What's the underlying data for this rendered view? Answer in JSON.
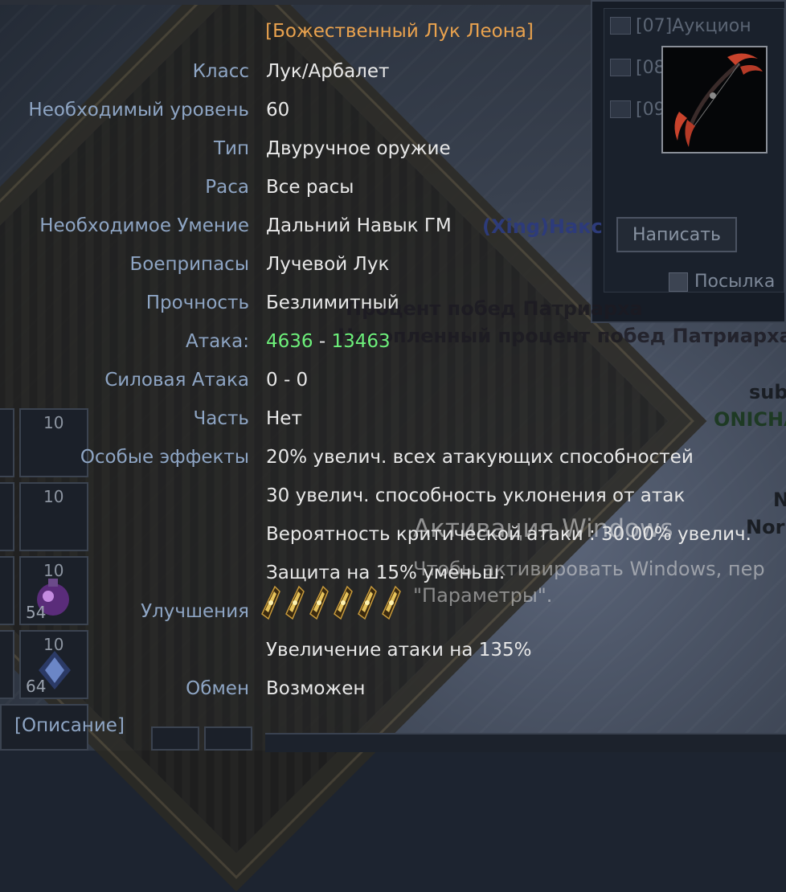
{
  "item": {
    "title": "[Божественный Лук Леона]",
    "properties": [
      {
        "label": "Класс",
        "value": "Лук/Арбалет"
      },
      {
        "label": "Необходимый уровень",
        "value": "60"
      },
      {
        "label": "Тип",
        "value": "Двуручное оружие"
      },
      {
        "label": "Раса",
        "value": "Все расы"
      },
      {
        "label": "Необходимое Умение",
        "value": "Дальний Навык ГМ"
      },
      {
        "label": "Боеприпасы",
        "value": "Лучевой Лук"
      },
      {
        "label": "Прочность",
        "value": "Безлимитный"
      }
    ],
    "attack": {
      "label": "Атака:",
      "min": "4636",
      "separator": "-",
      "max": "13463"
    },
    "power_attack": {
      "label": "Силовая Атака",
      "value": "0 - 0"
    },
    "part": {
      "label": "Часть",
      "value": "Нет"
    },
    "special_effects": {
      "label": "Особые эффекты",
      "lines": [
        "20% увелич. всех атакующих способностей",
        "30 увелич. способность уклонения от атак",
        "Вероятность критической атаки : 30.00% увелич.",
        "Защита на 15% уменьш."
      ]
    },
    "upgrades": {
      "label": "Улучшения",
      "gem_count": 6,
      "gem_icon": "upgrade-gem-icon",
      "bonus": "Увеличение атаки на 135%"
    },
    "trade": {
      "label": "Обмен",
      "value": "Возможен"
    },
    "description_link": "[Описание]"
  },
  "mail_window": {
    "rows": [
      "[07]Аукцион",
      "[08",
      "[09"
    ],
    "write_button": "Написать",
    "parcel": "Посылка"
  },
  "background_chat": {
    "line1": "(Xing)Накс",
    "line2": "Процент побед Патриарха",
    "line3": "Накопленный процент побед Патриарха",
    "line4": "sub",
    "line5": "ONICHA",
    "line6": "N",
    "line7": "Nor"
  },
  "inventory": {
    "slot_counts": [
      "10",
      "10",
      "10",
      "10"
    ],
    "slot_qty": [
      "54",
      "64"
    ]
  },
  "watermark": {
    "title": "Активация Windows",
    "line1": "Чтобы активировать Windows, пер",
    "line2": "\"Параметры\"."
  },
  "colors": {
    "title": "#e9a24e",
    "label": "#8ea5c4",
    "value": "#e8e8e8",
    "attack": "#6df07a"
  }
}
